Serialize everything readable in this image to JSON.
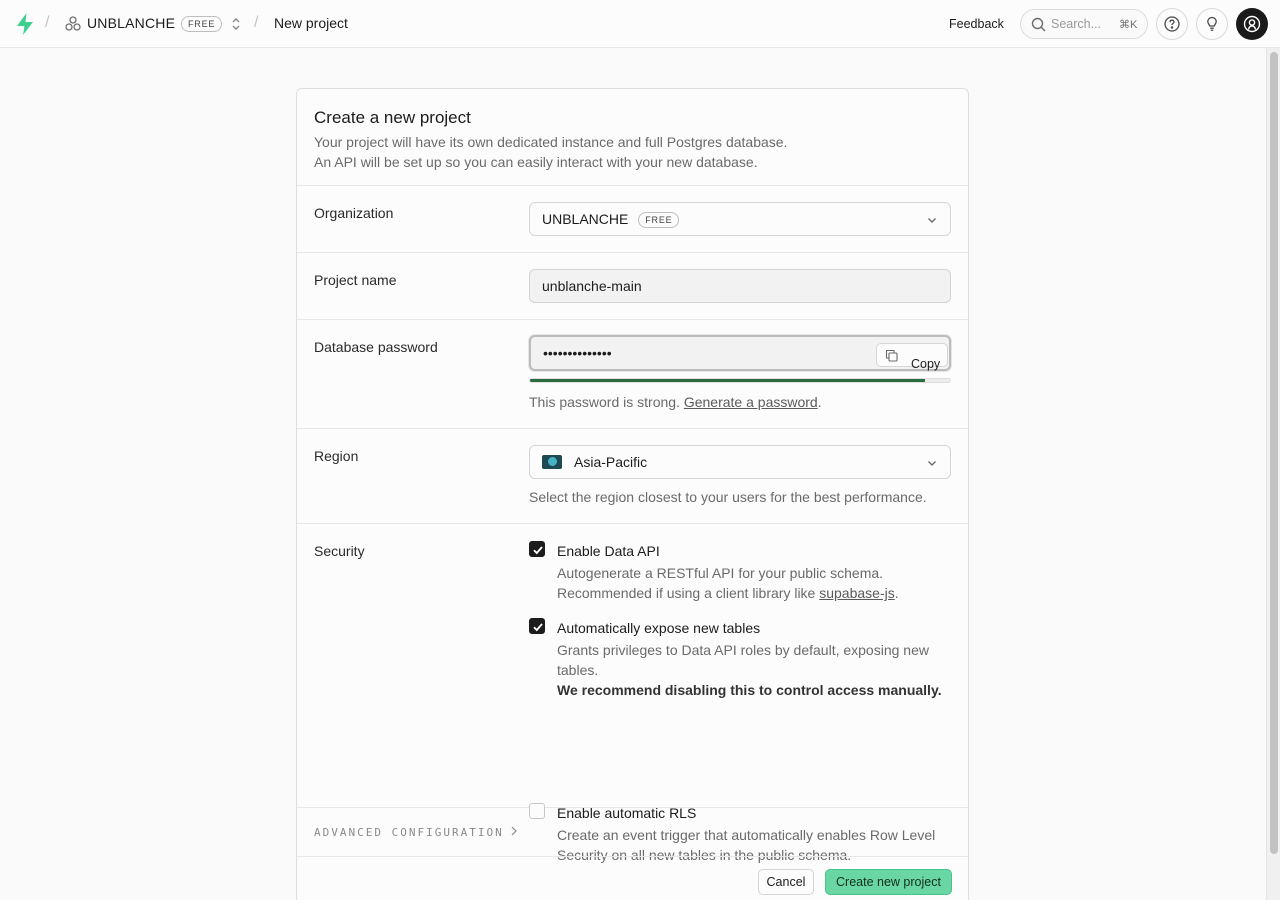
{
  "header": {
    "org_name": "UNBLANCHE",
    "org_badge": "FREE",
    "breadcrumb_current": "New project",
    "feedback_label": "Feedback",
    "search_placeholder": "Search...",
    "search_shortcut": "⌘K"
  },
  "card": {
    "title": "Create a new project",
    "subtitle_line1": "Your project will have its own dedicated instance and full Postgres database.",
    "subtitle_line2": "An API will be set up so you can easily interact with your new database."
  },
  "organization": {
    "label": "Organization",
    "value": "UNBLANCHE",
    "badge": "FREE"
  },
  "project_name": {
    "label": "Project name",
    "value": "unblanche-main"
  },
  "database_password": {
    "label": "Database password",
    "masked_value": "••••••••••••••",
    "copy_label": "Copy",
    "strength_fraction": 0.94,
    "strength_color": "#2a6b3f",
    "help_prefix": "This password is strong. ",
    "generate_link": "Generate a password",
    "help_suffix": "."
  },
  "region": {
    "label": "Region",
    "value": "Asia-Pacific",
    "help": "Select the region closest to your users for the best performance."
  },
  "security": {
    "label": "Security",
    "options": [
      {
        "title": "Enable Data API",
        "checked": true,
        "desc_line1": "Autogenerate a RESTful API for your public schema.",
        "desc_line2_prefix": "Recommended if using a client library like ",
        "desc_link": "supabase-js",
        "desc_line2_suffix": "."
      },
      {
        "title": "Automatically expose new tables",
        "checked": true,
        "desc_line1": "Grants privileges to Data API roles by default, exposing new",
        "desc_line2": "tables.",
        "desc_strong": "We recommend disabling this to control access manually."
      },
      {
        "title": "Enable automatic RLS",
        "checked": false,
        "desc_line1": "Create an event trigger that automatically enables Row Level",
        "desc_line2": "Security on all new tables in the public schema."
      }
    ]
  },
  "advanced": {
    "label": "ADVANCED CONFIGURATION"
  },
  "footer": {
    "cancel_label": "Cancel",
    "create_label": "Create new project"
  },
  "colors": {
    "accent": "#3ecf8e",
    "create_button": "#6ad6a3"
  }
}
